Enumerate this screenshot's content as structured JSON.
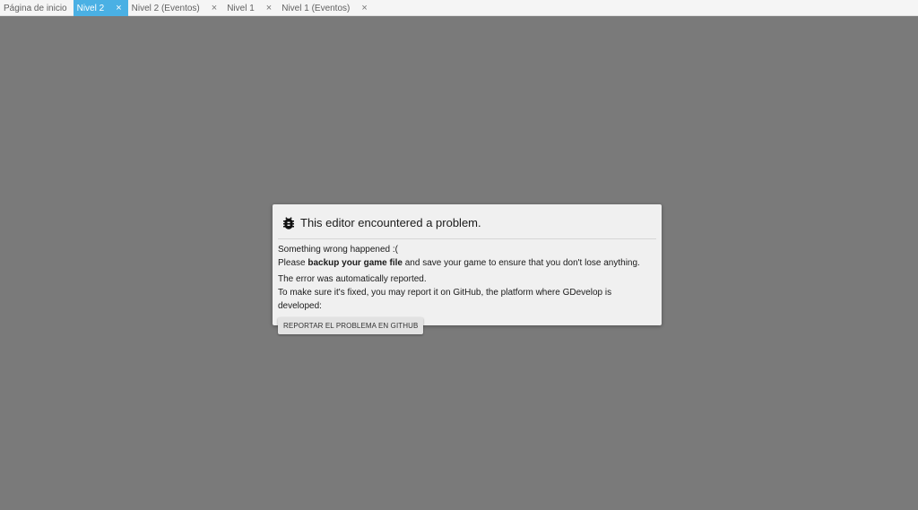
{
  "tabs": [
    {
      "label": "Página de inicio",
      "active": false,
      "closable": false
    },
    {
      "label": "Nivel 2",
      "active": true,
      "closable": true
    },
    {
      "label": "Nivel 2 (Eventos)",
      "active": false,
      "closable": true
    },
    {
      "label": "Nivel 1",
      "active": false,
      "closable": true
    },
    {
      "label": "Nivel 1 (Eventos)",
      "active": false,
      "closable": true
    }
  ],
  "close_glyph": "×",
  "dialog": {
    "title": "This editor encountered a problem.",
    "line1": "Something wrong happened :(",
    "line2_prefix": "Please ",
    "line2_bold": "backup your game file",
    "line2_suffix": " and save your game to ensure that you don't lose anything.",
    "line3": "The error was automatically reported.",
    "line4": "To make sure it's fixed, you may report it on GitHub, the platform where GDevelop is developed:",
    "button_label": "REPORTAR EL PROBLEMA EN GITHUB",
    "icon": "bug-icon"
  },
  "colors": {
    "background": "#7a7a7a",
    "active_tab": "#4ab0e4",
    "dialog_bg": "#f0f0f0"
  }
}
